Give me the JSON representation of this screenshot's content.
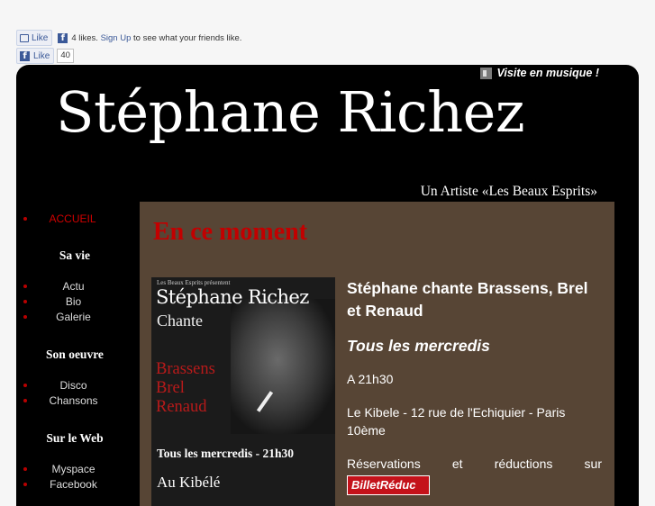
{
  "facebook": {
    "like_label": "Like",
    "likes_text": "4 likes.",
    "signup_link": "Sign Up",
    "signup_suffix": "to see what your friends like.",
    "like2_label": "Like",
    "like_count": "40",
    "brand_color": "#3b5998"
  },
  "header": {
    "music_link": "Visite en musique !",
    "site_title": "Stéphane Richez",
    "site_subtitle": "Un Artiste «Les Beaux Esprits»"
  },
  "sidebar": {
    "active_color": "#d00000",
    "accueil": "ACCUEIL",
    "section_vie": "Sa vie",
    "vie_items": [
      "Actu",
      "Bio",
      "Galerie"
    ],
    "section_oeuvre": "Son oeuvre",
    "oeuvre_items": [
      "Disco",
      "Chansons"
    ],
    "section_web": "Sur le Web",
    "web_items": [
      "Myspace",
      "Facebook"
    ]
  },
  "content": {
    "headline": "En ce moment",
    "poster": {
      "presenter": "Les Beaux Esprits présentent",
      "name": "Stéphane Richez",
      "chante": "Chante",
      "artists": [
        "Brassens",
        "Brel",
        "Renaud"
      ],
      "date": "Tous les mercredis - 21h30",
      "venue": "Au Kibélé"
    },
    "event_title": "Stéphane chante Brassens, Brel et Renaud",
    "event_day": "Tous les mercredis",
    "event_time": "A 21h30",
    "event_address": "Le Kibele - 12 rue de l'Echiquier - Paris 10ème",
    "reservation_text": "Réservations et réductions sur",
    "billet_label": "BilletRéduc"
  }
}
